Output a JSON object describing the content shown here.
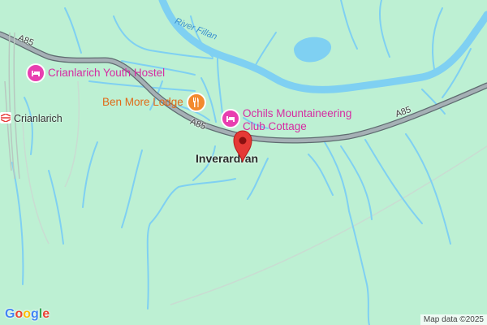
{
  "map": {
    "places": {
      "hostel": "Crianlarich Youth Hostel",
      "lodge": "Ben More Lodge",
      "cottage_line1": "Ochils Mountaineering",
      "cottage_line2": "Club Cottage",
      "station": "Crianlarich",
      "village": "Inverardran"
    },
    "river": "River Fillan",
    "road_shields": [
      "A85",
      "A85",
      "A85"
    ],
    "credit": "Map data ©2025",
    "logo_letters": [
      "G",
      "o",
      "o",
      "g",
      "l",
      "e"
    ],
    "colors": {
      "land": "#bdf0d3",
      "water": "#7fd0f2",
      "road": "#9aa7ad",
      "road_edge": "#5f6b70",
      "marker": "#e53935",
      "poi_pink": "#d62ba2",
      "poi_orange": "#e06a18",
      "logo": [
        "#4285f4",
        "#ea4335",
        "#fbbc05",
        "#4285f4",
        "#34a853",
        "#ea4335"
      ]
    },
    "icons": [
      "lodging-icon",
      "restaurant-icon",
      "train-station-icon",
      "map-pin-icon"
    ]
  }
}
